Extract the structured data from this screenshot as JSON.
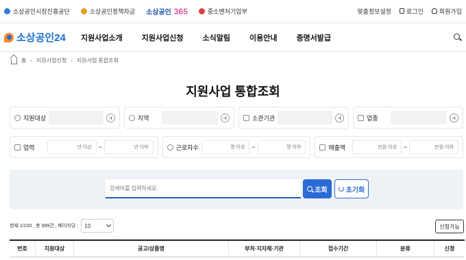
{
  "topbar": {
    "sites": [
      {
        "label": "소상공인시장진흥공단",
        "color": "#2f7bd6"
      },
      {
        "label": "소상공인정책자금",
        "color": "#e0a020"
      },
      {
        "label": "",
        "color": ""
      },
      {
        "label": "중소벤처기업부",
        "color": "#d94040"
      }
    ],
    "brand365_a": "소상공인",
    "brand365_b": "365",
    "util": [
      "맞춤정보설정",
      "로그인",
      "회원가입"
    ]
  },
  "gnb": {
    "logo": "소상공인24",
    "menu": [
      "지원사업소개",
      "지원사업신청",
      "소식알림",
      "이용안내",
      "증명서발급"
    ]
  },
  "breadcrumb": {
    "home": "홈",
    "items": [
      "지원사업신청",
      "지원사업 통합조회"
    ]
  },
  "page_title": "지원사업 통합조회",
  "filters_row1": [
    "지원대상",
    "지역",
    "소관기관",
    "업종"
  ],
  "filters_row2": [
    {
      "label": "업력",
      "from": "년 이상",
      "to": "년 이하"
    },
    {
      "label": "근로자수",
      "from": "명 이상",
      "to": "명 이하"
    },
    {
      "label": "매출액",
      "from": "만원 이상",
      "to": "만원 이하"
    }
  ],
  "range_sep": "~",
  "search": {
    "placeholder": "검색어를 입력하세요.",
    "search_label": "조회",
    "reset_label": "초기화"
  },
  "results": {
    "summary": "현재 1/100 , 총 999건 , 페이지당 :",
    "per_page": "10",
    "apply_label": "신청가능"
  },
  "table": {
    "columns": [
      "번호",
      "지원대상",
      "공고/상품명",
      "부처·지자체·기관",
      "접수기간",
      "분류",
      "신청"
    ]
  },
  "colors": {
    "accent": "#2a6ad6",
    "logo": "#1a6fd1",
    "logo_mark": "#ff8a2a"
  }
}
